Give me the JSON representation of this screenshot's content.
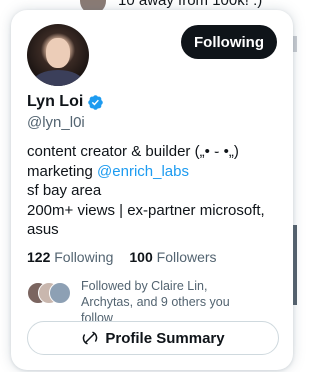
{
  "background": {
    "top_text": "10 away from 100k! :)"
  },
  "profile": {
    "name": "Lyn Loi",
    "handle": "@lyn_l0i",
    "follow_button": "Following",
    "bio": {
      "line1": "content creator & builder („• ֊ •„)",
      "line2_prefix": "marketing ",
      "line2_link": "@enrich_labs",
      "line3": "sf bay area",
      "line4": "200m+ views | ex-partner microsoft,",
      "line5": "asus"
    },
    "stats": {
      "following_count": "122",
      "following_label": "Following",
      "followers_count": "100",
      "followers_label": "Followers"
    },
    "followed_by": "Followed by Claire Lin, Archytas, and 9 others you follow",
    "summary_button": "Profile Summary",
    "icons": {
      "verified": "verified-badge-icon",
      "summary": "grok-icon"
    },
    "colors": {
      "accent": "#1d9bf0",
      "button_dark": "#0f1419",
      "muted_text": "#536471"
    }
  }
}
